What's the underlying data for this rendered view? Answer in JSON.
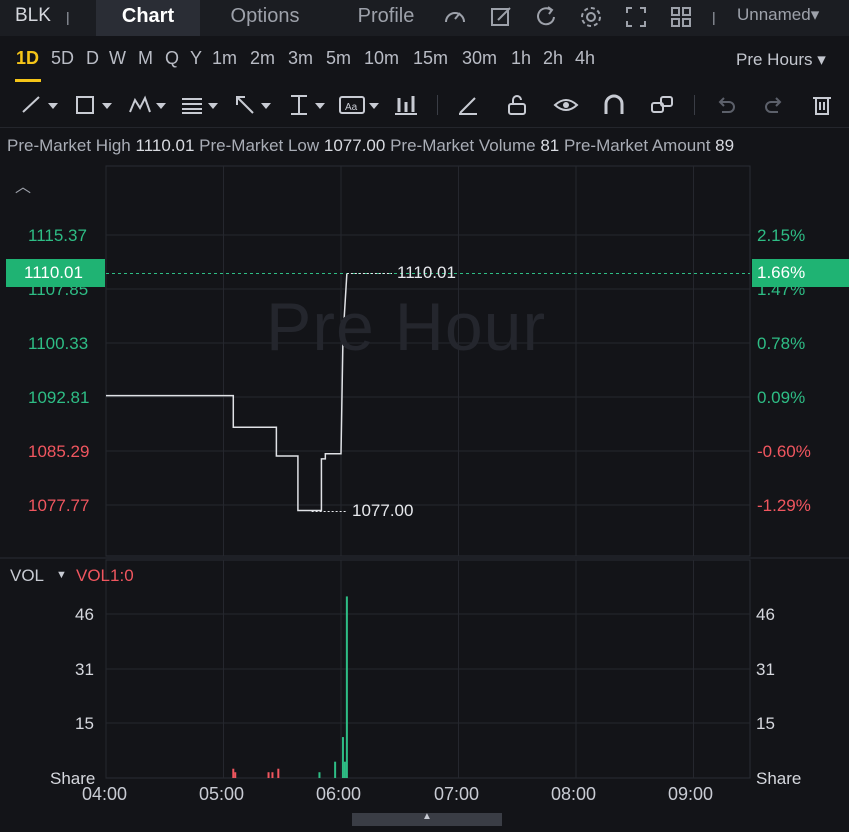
{
  "header": {
    "ticker": "BLK",
    "separator": "|",
    "tabs": [
      {
        "label": "Chart",
        "active": true
      },
      {
        "label": "Options",
        "active": false
      },
      {
        "label": "Profile",
        "active": false
      }
    ],
    "icons": [
      "gauge-icon",
      "edit-icon",
      "refresh-icon",
      "settings-icon",
      "fullscreen-icon",
      "grid-icon"
    ],
    "layout_name": "Unnamed▾"
  },
  "intervals": {
    "items": [
      "1D",
      "5D",
      "D",
      "W",
      "M",
      "Q",
      "Y",
      "1m",
      "2m",
      "3m",
      "5m",
      "10m",
      "15m",
      "30m",
      "1h",
      "2h",
      "4h"
    ],
    "active": "1D",
    "session": "Pre Hours ▾"
  },
  "toolbar": {
    "tools": [
      "line-tool-icon",
      "rectangle-tool-icon",
      "pattern-tool-icon",
      "fib-tool-icon",
      "arrow-tool-icon",
      "measure-tool-icon",
      "text-tool-icon",
      "bars-tool-icon",
      "pen-icon",
      "unlock-icon",
      "eye-icon",
      "magnet-icon",
      "link-icon",
      "undo-icon",
      "redo-icon",
      "trash-icon"
    ]
  },
  "info": {
    "high_label": "Pre-Market High",
    "high_value": "1110.01",
    "low_label": "Pre-Market Low",
    "low_value": "1077.00",
    "volume_label": "Pre-Market Volume",
    "volume_value": "81",
    "amount_label": "Pre-Market Amount",
    "amount_value": "89"
  },
  "price_axis": {
    "left_labels": [
      "1115.37",
      "1107.85",
      "1100.33",
      "1092.81",
      "1085.29",
      "1077.77"
    ],
    "right_labels": [
      "2.15%",
      "1.47%",
      "0.78%",
      "0.09%",
      "-0.60%",
      "-1.29%"
    ],
    "current_price": "1110.01",
    "current_pct": "1.66%"
  },
  "watermark": "Pre Hour",
  "annotations": {
    "high": "1110.01",
    "low": "1077.00"
  },
  "volume": {
    "title": "VOL",
    "indicator": "VOL1:0",
    "left_labels": [
      "46",
      "31",
      "15",
      "Share"
    ],
    "right_labels": [
      "46",
      "31",
      "15",
      "Share"
    ]
  },
  "time_axis": [
    "04:00",
    "05:00",
    "06:00",
    "07:00",
    "08:00",
    "09:00"
  ],
  "colors": {
    "up": "#2ebd85",
    "down": "#f0565f",
    "accent": "#f5c518",
    "price_line": "#e0e2e6"
  },
  "chart_data": {
    "type": "line",
    "x": [
      "05:04",
      "05:05",
      "05:25",
      "05:27",
      "05:29",
      "05:38",
      "05:45",
      "05:50",
      "05:52",
      "06:00",
      "06:01",
      "06:03"
    ],
    "y": [
      1093.0,
      1088.6,
      1088.6,
      1084.6,
      1084.6,
      1077.0,
      1077.0,
      1084.2,
      1084.9,
      1084.9,
      1101.0,
      1110.01
    ],
    "volume": {
      "x": [
        "05:05",
        "05:06",
        "05:23",
        "05:25",
        "05:28",
        "05:49",
        "05:57",
        "06:01",
        "06:02",
        "06:03"
      ],
      "values": [
        2,
        1,
        1,
        1,
        2,
        1,
        4,
        11,
        4,
        51
      ],
      "direction": [
        "down",
        "down",
        "down",
        "down",
        "down",
        "up",
        "up",
        "up",
        "up",
        "up"
      ]
    },
    "ylim": [
      1075.0,
      1118.5
    ],
    "vol_ylim": [
      0,
      54
    ],
    "xlim": [
      "04:00",
      "09:30"
    ]
  }
}
